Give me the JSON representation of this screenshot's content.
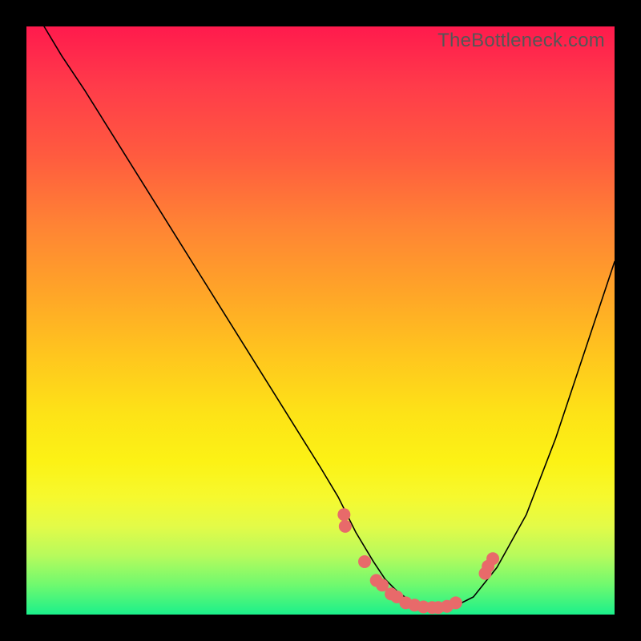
{
  "watermark": "TheBottleneck.com",
  "colors": {
    "frame": "#000000",
    "gradient_top": "#ff1a4d",
    "gradient_bottom": "#1bf08b",
    "curve": "#000000",
    "dot": "#e86a6a",
    "watermark": "#565656"
  },
  "chart_data": {
    "type": "line",
    "title": "",
    "xlabel": "",
    "ylabel": "",
    "xlim": [
      0,
      100
    ],
    "ylim": [
      0,
      100
    ],
    "grid": false,
    "legend": false,
    "series": [
      {
        "name": "curve",
        "x": [
          3,
          6,
          10,
          15,
          20,
          25,
          30,
          35,
          40,
          45,
          50,
          53,
          56,
          59,
          61,
          63,
          65,
          67,
          69,
          71,
          73,
          76,
          80,
          85,
          90,
          95,
          100
        ],
        "values": [
          100,
          95,
          89,
          81,
          73,
          65,
          57,
          49,
          41,
          33,
          25,
          20,
          14,
          9,
          6,
          4,
          2.5,
          1.5,
          1,
          1,
          1.5,
          3,
          8,
          17,
          30,
          45,
          60
        ]
      }
    ],
    "scatter_points": {
      "name": "dots",
      "x": [
        54,
        54.2,
        57.5,
        59.5,
        60.5,
        62,
        63,
        64.5,
        66,
        67.5,
        69,
        70,
        71.5,
        73,
        78,
        78.5,
        79.3
      ],
      "values": [
        17,
        15,
        9,
        5.8,
        5,
        3.5,
        3,
        2,
        1.6,
        1.3,
        1.2,
        1.2,
        1.4,
        2.0,
        7.0,
        8.2,
        9.5
      ]
    }
  }
}
